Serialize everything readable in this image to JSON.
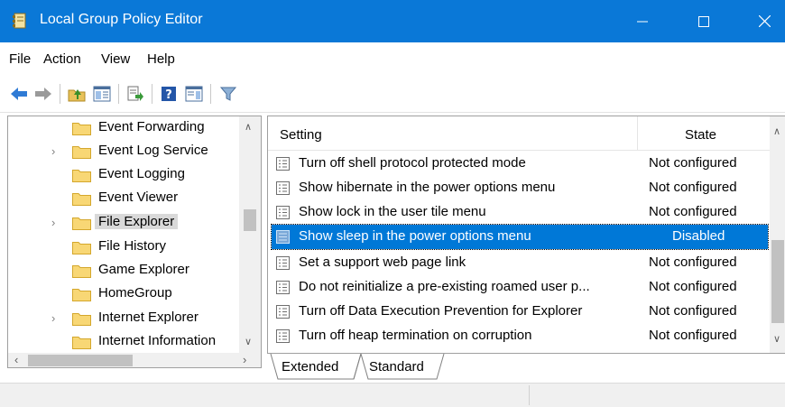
{
  "window": {
    "title": "Local Group Policy Editor",
    "accent_color": "#0a78d7",
    "controls": [
      "minimize-icon",
      "maximize-icon",
      "close-icon"
    ]
  },
  "menu": {
    "file": "File",
    "action": "Action",
    "view": "View",
    "help": "Help"
  },
  "toolbar": {
    "buttons": [
      "back-arrow-icon",
      "forward-arrow-icon",
      "up-folder-icon",
      "show-hide-tree-icon",
      "export-list-icon",
      "help-icon",
      "properties-icon",
      "filter-icon"
    ]
  },
  "tree": {
    "items": [
      {
        "label": "Event Forwarding",
        "expandable": false
      },
      {
        "label": "Event Log Service",
        "expandable": true
      },
      {
        "label": "Event Logging",
        "expandable": false
      },
      {
        "label": "Event Viewer",
        "expandable": false
      },
      {
        "label": "File Explorer",
        "expandable": true,
        "selected": true
      },
      {
        "label": "File History",
        "expandable": false
      },
      {
        "label": "Game Explorer",
        "expandable": false
      },
      {
        "label": "HomeGroup",
        "expandable": false
      },
      {
        "label": "Internet Explorer",
        "expandable": true
      },
      {
        "label": "Internet Information",
        "expandable": false
      }
    ]
  },
  "list": {
    "columns": {
      "setting": "Setting",
      "state": "State"
    },
    "rows": [
      {
        "name": "Turn off shell protocol protected mode",
        "state": "Not configured"
      },
      {
        "name": "Show hibernate in the power options menu",
        "state": "Not configured"
      },
      {
        "name": "Show lock in the user tile menu",
        "state": "Not configured"
      },
      {
        "name": "Show sleep in the power options menu",
        "state": "Disabled",
        "selected": true
      },
      {
        "name": "Set a support web page link",
        "state": "Not configured"
      },
      {
        "name": "Do not reinitialize a pre-existing roamed user p...",
        "state": "Not configured"
      },
      {
        "name": "Turn off Data Execution Prevention for Explorer",
        "state": "Not configured"
      },
      {
        "name": "Turn off heap termination on corruption",
        "state": "Not configured"
      }
    ],
    "selection_color": "#0078d7"
  },
  "tabs": {
    "extended": "Extended",
    "standard": "Standard"
  }
}
